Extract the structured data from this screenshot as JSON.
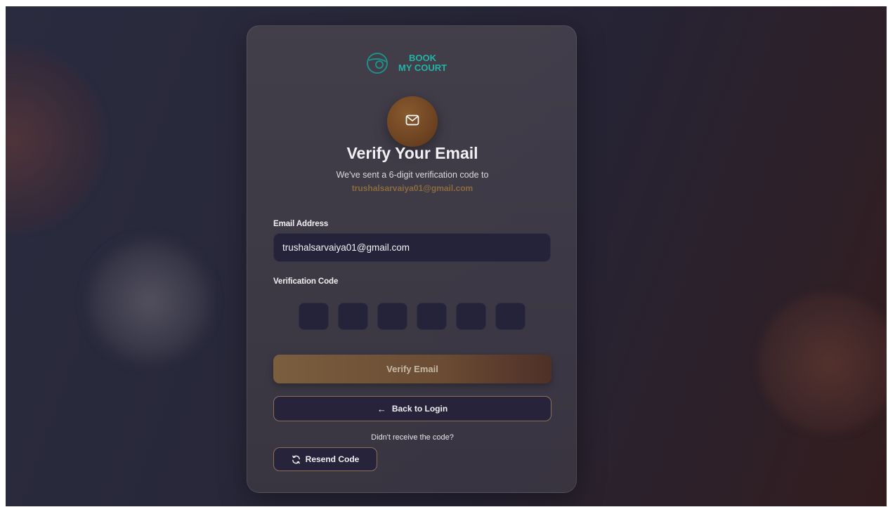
{
  "brand": {
    "line1": "BOOK",
    "line2": "MY COURT",
    "logo_icon": "globe-ball-icon",
    "color": "#22b3a6"
  },
  "header": {
    "badge_icon": "mail-icon",
    "title": "Verify Your Email",
    "subtitle": "We've sent a 6-digit verification code to",
    "email": "trushalsarvaiya01@gmail.com"
  },
  "form": {
    "email_label": "Email Address",
    "email_value": "trushalsarvaiya01@gmail.com",
    "code_label": "Verification Code",
    "code_digits": [
      "",
      "",
      "",
      "",
      "",
      ""
    ]
  },
  "actions": {
    "verify_label": "Verify Email",
    "back_label": "Back to Login",
    "back_icon": "arrow-left-icon",
    "no_code_text": "Didn't receive the code?",
    "resend_label": "Resend Code",
    "resend_icon": "refresh-icon"
  },
  "colors": {
    "accent_brown": "#7a5e3e",
    "input_bg": "#25233a",
    "email_highlight": "#8a6b3e"
  }
}
